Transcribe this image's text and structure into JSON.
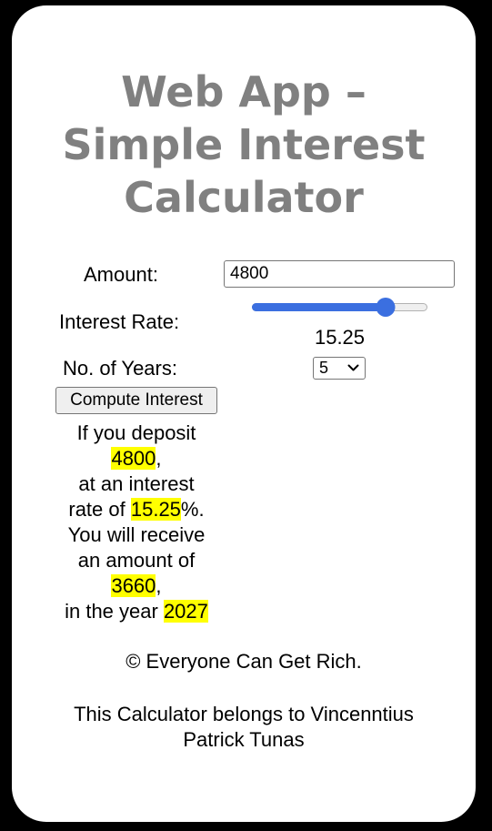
{
  "app": {
    "title_line1": "Web App –",
    "title_line2": "Simple Interest",
    "title_line3": "Calculator"
  },
  "form": {
    "amount_label": "Amount:",
    "amount_value": "4800",
    "rate_label": "Interest Rate:",
    "rate_value": "15.25",
    "rate_fraction": 0.76,
    "years_label": "No. of Years:",
    "years_selected": "5",
    "compute_label": "Compute Interest"
  },
  "result": {
    "line1": "If you deposit",
    "amount": "4800",
    "comma1": ",",
    "line2": "at an interest",
    "line3_prefix": "rate of ",
    "rate": "15.25",
    "percent": "%.",
    "line4": "You will receive",
    "line5": "an amount of",
    "interest": "3660",
    "comma2": ",",
    "line6_prefix": "in the year ",
    "year": "2027"
  },
  "footer": {
    "copyright": "© Everyone Can Get Rich.",
    "owner": "This Calculator belongs to Vincenntius Patrick Tunas"
  },
  "colors": {
    "accent": "#3b6fe0",
    "highlight": "#ffff00",
    "title": "#808080"
  }
}
